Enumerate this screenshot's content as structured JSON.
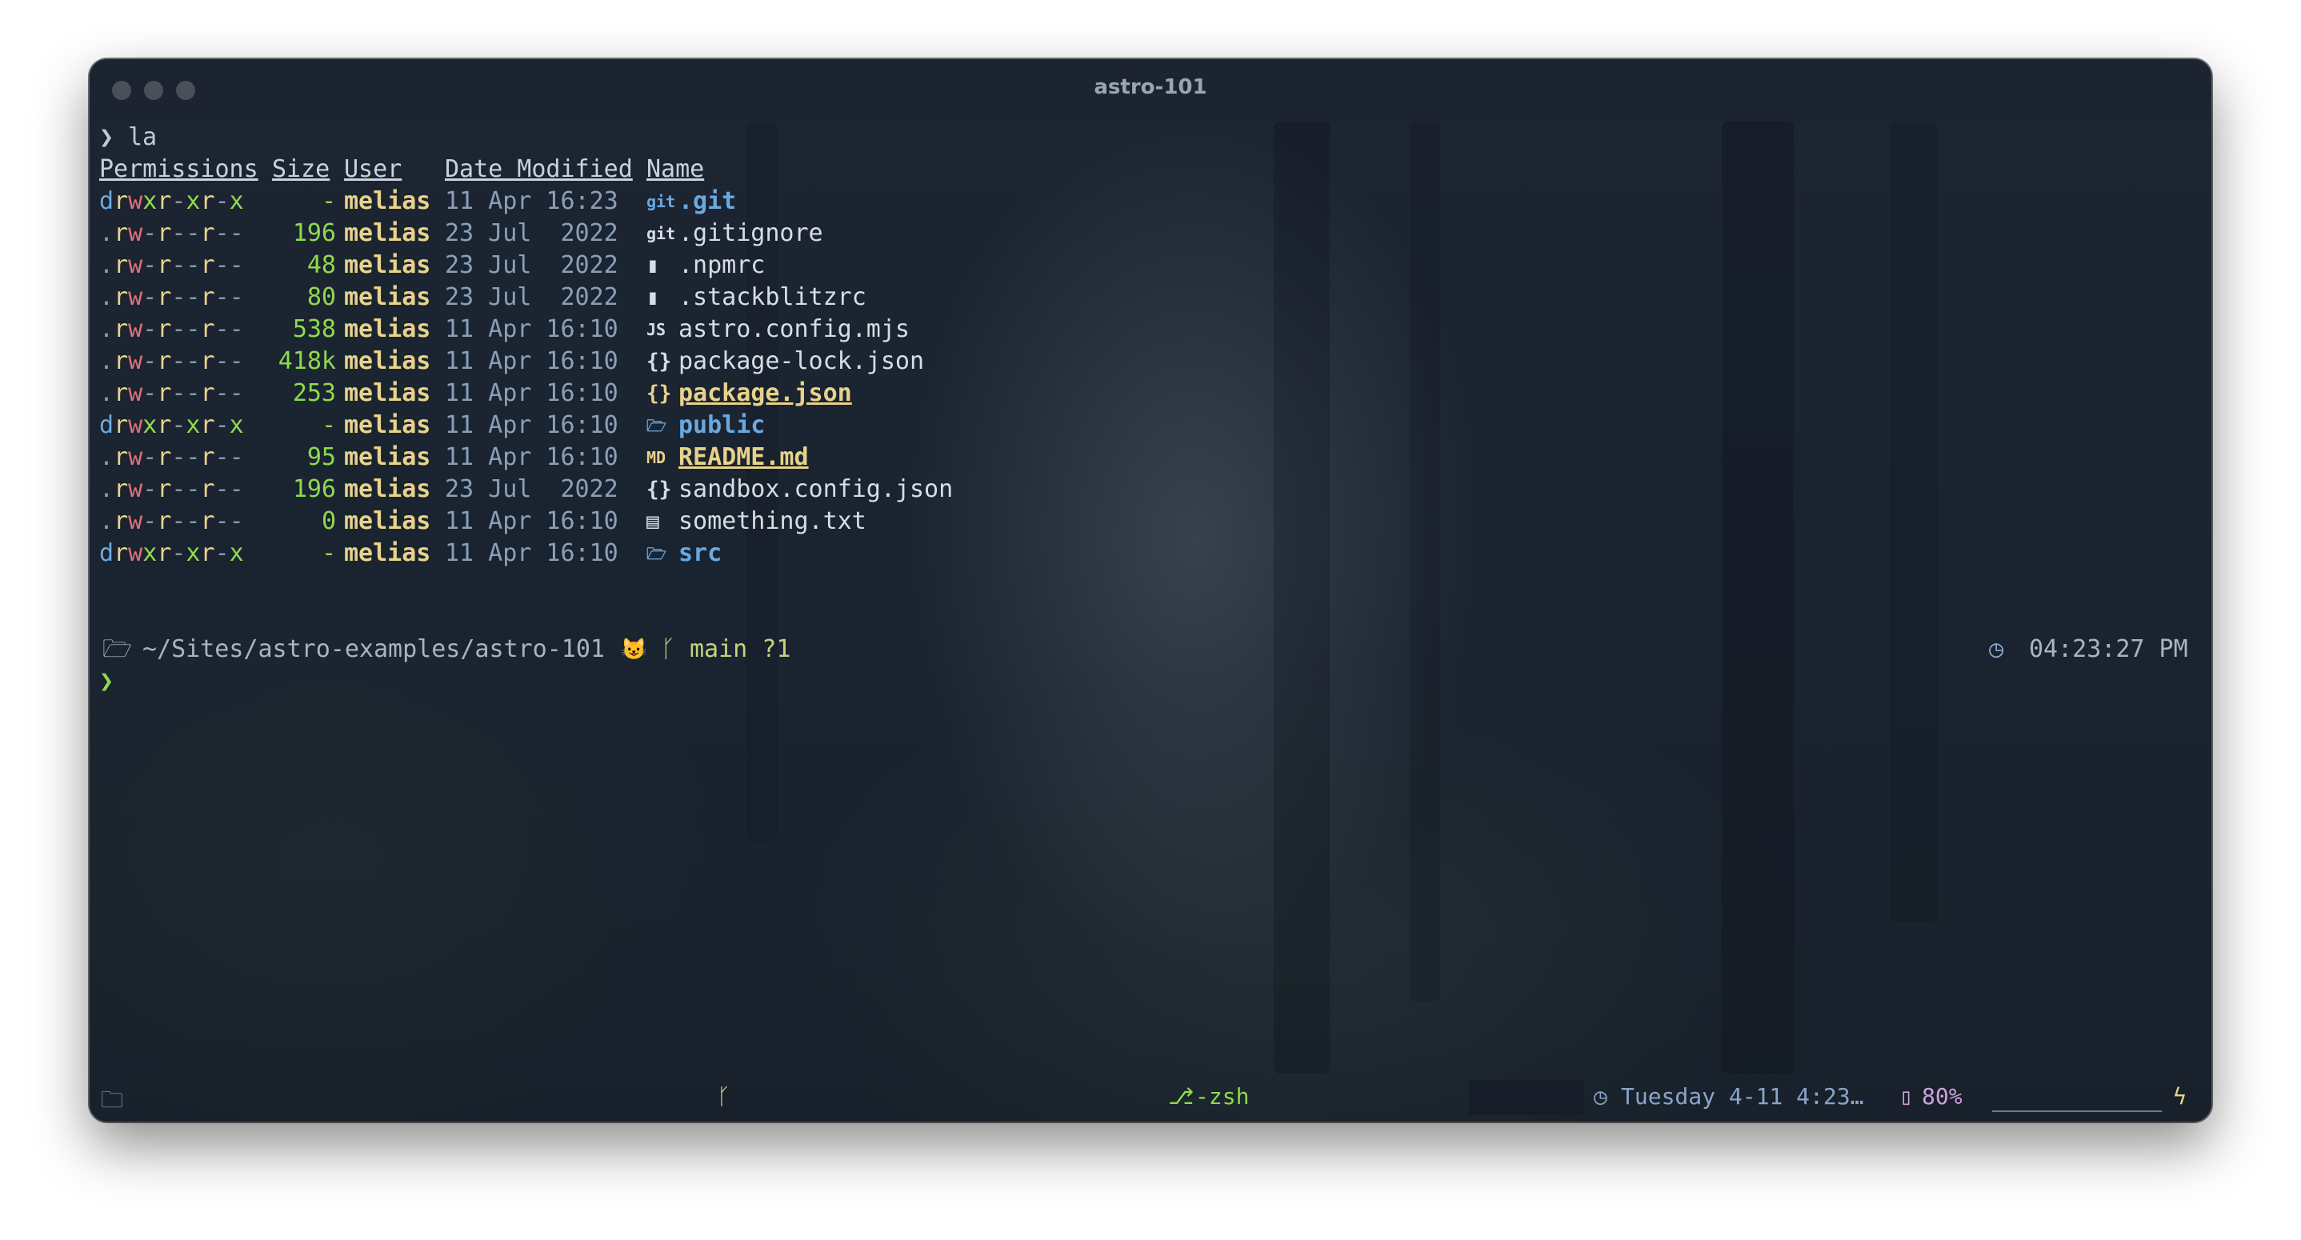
{
  "window": {
    "title": "astro-101"
  },
  "command": {
    "prompt_symbol": "❯",
    "text": "la"
  },
  "listing": {
    "headers": {
      "permissions": "Permissions",
      "size": "Size",
      "user": "User",
      "date": "Date Modified",
      "name": "Name"
    },
    "rows": [
      {
        "perm": [
          "d",
          "r",
          "w",
          "x",
          "r",
          "-",
          "x",
          "r",
          "-",
          "x"
        ],
        "size": "-",
        "user": "melias",
        "date": "11 Apr 16:23",
        "icon": "git",
        "name": ".git",
        "kind": "git"
      },
      {
        "perm": [
          ".",
          "r",
          "w",
          "-",
          "r",
          "-",
          "-",
          "r",
          "-",
          "-"
        ],
        "size": "196",
        "user": "melias",
        "date": "23 Jul  2022",
        "icon": "git",
        "name": ".gitignore",
        "kind": "file"
      },
      {
        "perm": [
          ".",
          "r",
          "w",
          "-",
          "r",
          "-",
          "-",
          "r",
          "-",
          "-"
        ],
        "size": "48",
        "user": "melias",
        "date": "23 Jul  2022",
        "icon": "▮",
        "name": ".npmrc",
        "kind": "file"
      },
      {
        "perm": [
          ".",
          "r",
          "w",
          "-",
          "r",
          "-",
          "-",
          "r",
          "-",
          "-"
        ],
        "size": "80",
        "user": "melias",
        "date": "23 Jul  2022",
        "icon": "▮",
        "name": ".stackblitzrc",
        "kind": "file"
      },
      {
        "perm": [
          ".",
          "r",
          "w",
          "-",
          "r",
          "-",
          "-",
          "r",
          "-",
          "-"
        ],
        "size": "538",
        "user": "melias",
        "date": "11 Apr 16:10",
        "icon": "JS",
        "name": "astro.config.mjs",
        "kind": "file"
      },
      {
        "perm": [
          ".",
          "r",
          "w",
          "-",
          "r",
          "-",
          "-",
          "r",
          "-",
          "-"
        ],
        "size": "418k",
        "user": "melias",
        "date": "11 Apr 16:10",
        "icon": "{}",
        "name": "package-lock.json",
        "kind": "file"
      },
      {
        "perm": [
          ".",
          "r",
          "w",
          "-",
          "r",
          "-",
          "-",
          "r",
          "-",
          "-"
        ],
        "size": "253",
        "user": "melias",
        "date": "11 Apr 16:10",
        "icon": "{}",
        "name": "package.json",
        "kind": "highlight"
      },
      {
        "perm": [
          "d",
          "r",
          "w",
          "x",
          "r",
          "-",
          "x",
          "r",
          "-",
          "x"
        ],
        "size": "-",
        "user": "melias",
        "date": "11 Apr 16:10",
        "icon": "🗁",
        "name": "public",
        "kind": "dir"
      },
      {
        "perm": [
          ".",
          "r",
          "w",
          "-",
          "r",
          "-",
          "-",
          "r",
          "-",
          "-"
        ],
        "size": "95",
        "user": "melias",
        "date": "11 Apr 16:10",
        "icon": "MD",
        "name": "README.md",
        "kind": "highlight"
      },
      {
        "perm": [
          ".",
          "r",
          "w",
          "-",
          "r",
          "-",
          "-",
          "r",
          "-",
          "-"
        ],
        "size": "196",
        "user": "melias",
        "date": "23 Jul  2022",
        "icon": "{}",
        "name": "sandbox.config.json",
        "kind": "file"
      },
      {
        "perm": [
          ".",
          "r",
          "w",
          "-",
          "r",
          "-",
          "-",
          "r",
          "-",
          "-"
        ],
        "size": "0",
        "user": "melias",
        "date": "11 Apr 16:10",
        "icon": "▤",
        "name": "something.txt",
        "kind": "file"
      },
      {
        "perm": [
          "d",
          "r",
          "w",
          "x",
          "r",
          "-",
          "x",
          "r",
          "-",
          "x"
        ],
        "size": "-",
        "user": "melias",
        "date": "11 Apr 16:10",
        "icon": "🗁",
        "name": "src",
        "kind": "dir"
      }
    ]
  },
  "prompt": {
    "folder_icon": "folder-open-icon",
    "path": "~/Sites/astro-examples/astro-101",
    "git_icon": "github-cat-icon",
    "branch_icon": "branch-icon",
    "branch": "main ?1",
    "clock_icon": "clock-icon",
    "time": "04:23:27 PM",
    "cursor_symbol": "❯"
  },
  "statusbar": {
    "folder_icon": "folder-icon",
    "branch_icon": "branch-icon",
    "shell_icon": "shell-icon",
    "shell": "-zsh",
    "clock_icon": "clock-icon",
    "datetime": "Tuesday 4-11 4:23…",
    "battery_icon": "battery-icon",
    "battery": "80%",
    "charging_icon": "bolt-icon"
  }
}
